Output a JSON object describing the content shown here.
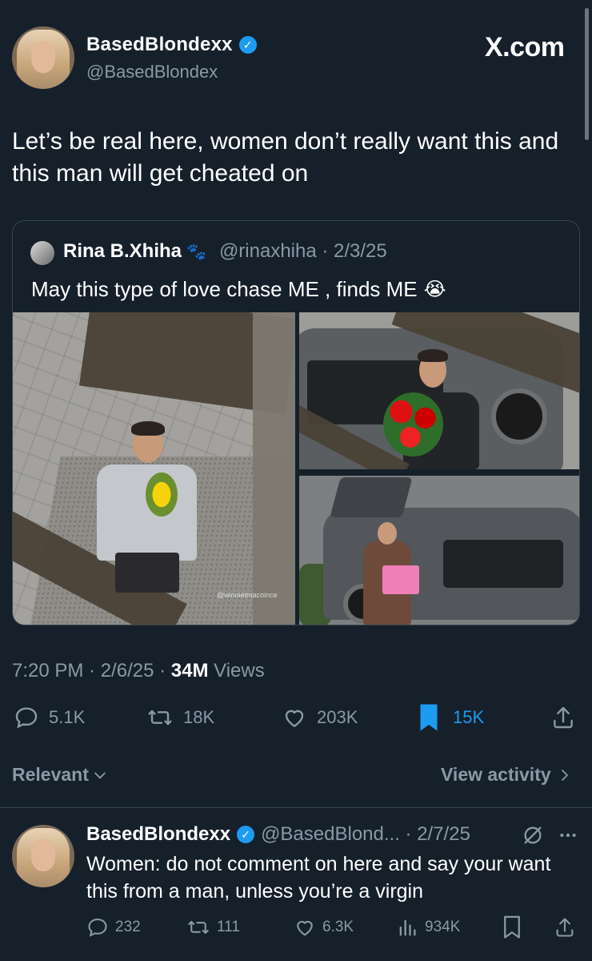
{
  "post": {
    "author_name": "BasedBlondexx",
    "author_handle": "@BasedBlondex",
    "site_label": "X.com",
    "text": "Let’s be real here, women don’t really want this and this man will get cheated on",
    "quote": {
      "author_name": "Rina B.Xhiha",
      "author_emoji": "🐾",
      "handle_date": "@rinaxhiha · 2/3/25",
      "text": "May this type of love chase ME , finds ME",
      "text_emoji": "😭",
      "watermark": "@winnietmacoince"
    },
    "time": "7:20 PM · 2/6/25 · ",
    "views_count": "34M",
    "views_label": " Views",
    "actions": {
      "replies": "5.1K",
      "reposts": "18K",
      "likes": "203K",
      "bookmarks": "15K"
    }
  },
  "toolbar": {
    "sort_label": "Relevant",
    "view_activity_label": "View activity"
  },
  "reply": {
    "author_name": "BasedBlondexx",
    "handle_date": "@BasedBlond... · 2/7/25",
    "text": "Women: do not comment on here and say your want this from a man, unless you’re a virgin",
    "actions": {
      "replies": "232",
      "reposts": "111",
      "likes": "6.3K",
      "views": "934K"
    }
  },
  "colors": {
    "background": "#15202b",
    "accent": "#1d9bf0",
    "muted": "#8b98a5",
    "border": "#38444d"
  },
  "icons": [
    "verified-badge-icon",
    "reply-icon",
    "repost-icon",
    "like-icon",
    "bookmark-icon",
    "share-icon",
    "views-icon",
    "chevron-down-icon",
    "chevron-right-icon",
    "grok-icon",
    "more-icon"
  ]
}
